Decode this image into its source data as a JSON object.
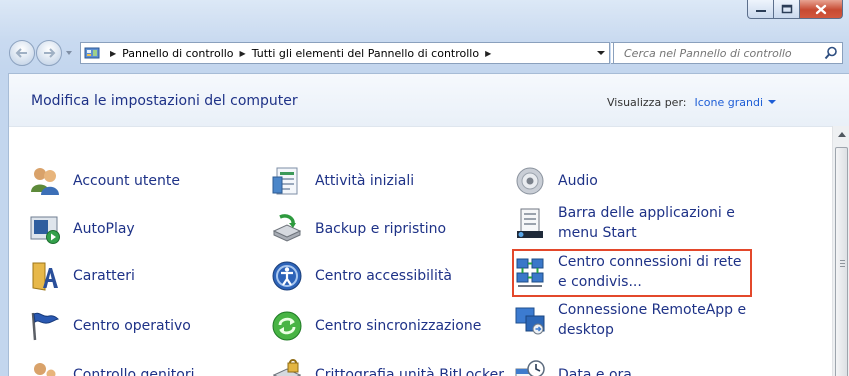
{
  "window": {
    "caption_buttons": [
      "minimize-icon",
      "maximize-icon",
      "close-icon"
    ]
  },
  "navigation": {
    "breadcrumb": [
      "Pannello di controllo",
      "Tutti gli elementi del Pannello di controllo"
    ],
    "search_placeholder": "Cerca nel Pannello di controllo"
  },
  "header": {
    "title": "Modifica le impostazioni del computer",
    "view_by_label": "Visualizza per:",
    "view_by_value": "Icone grandi"
  },
  "items": {
    "account_utente": "Account utente",
    "attivita_iniziali": "Attività iniziali",
    "audio": "Audio",
    "autoplay": "AutoPlay",
    "backup": "Backup e ripristino",
    "barra_1": "Barra delle applicazioni e",
    "barra_2": "menu Start",
    "caratteri": "Caratteri",
    "accessibilita": "Centro accessibilità",
    "centro_conn_1": "Centro connessioni di rete",
    "centro_conn_2": "e condivis...",
    "centro_operativo": "Centro operativo",
    "centro_sync": "Centro sincronizzazione",
    "remoteapp_1": "Connessione RemoteApp e",
    "remoteapp_2": "desktop",
    "controllo_genitori": "Controllo genitori",
    "bitlocker": "Crittografia unità BitLocker",
    "data_ora": "Data e ora"
  },
  "colors": {
    "link": "#1e3287",
    "highlight_box": "#e3482b",
    "view_value": "#1e5ed6"
  }
}
